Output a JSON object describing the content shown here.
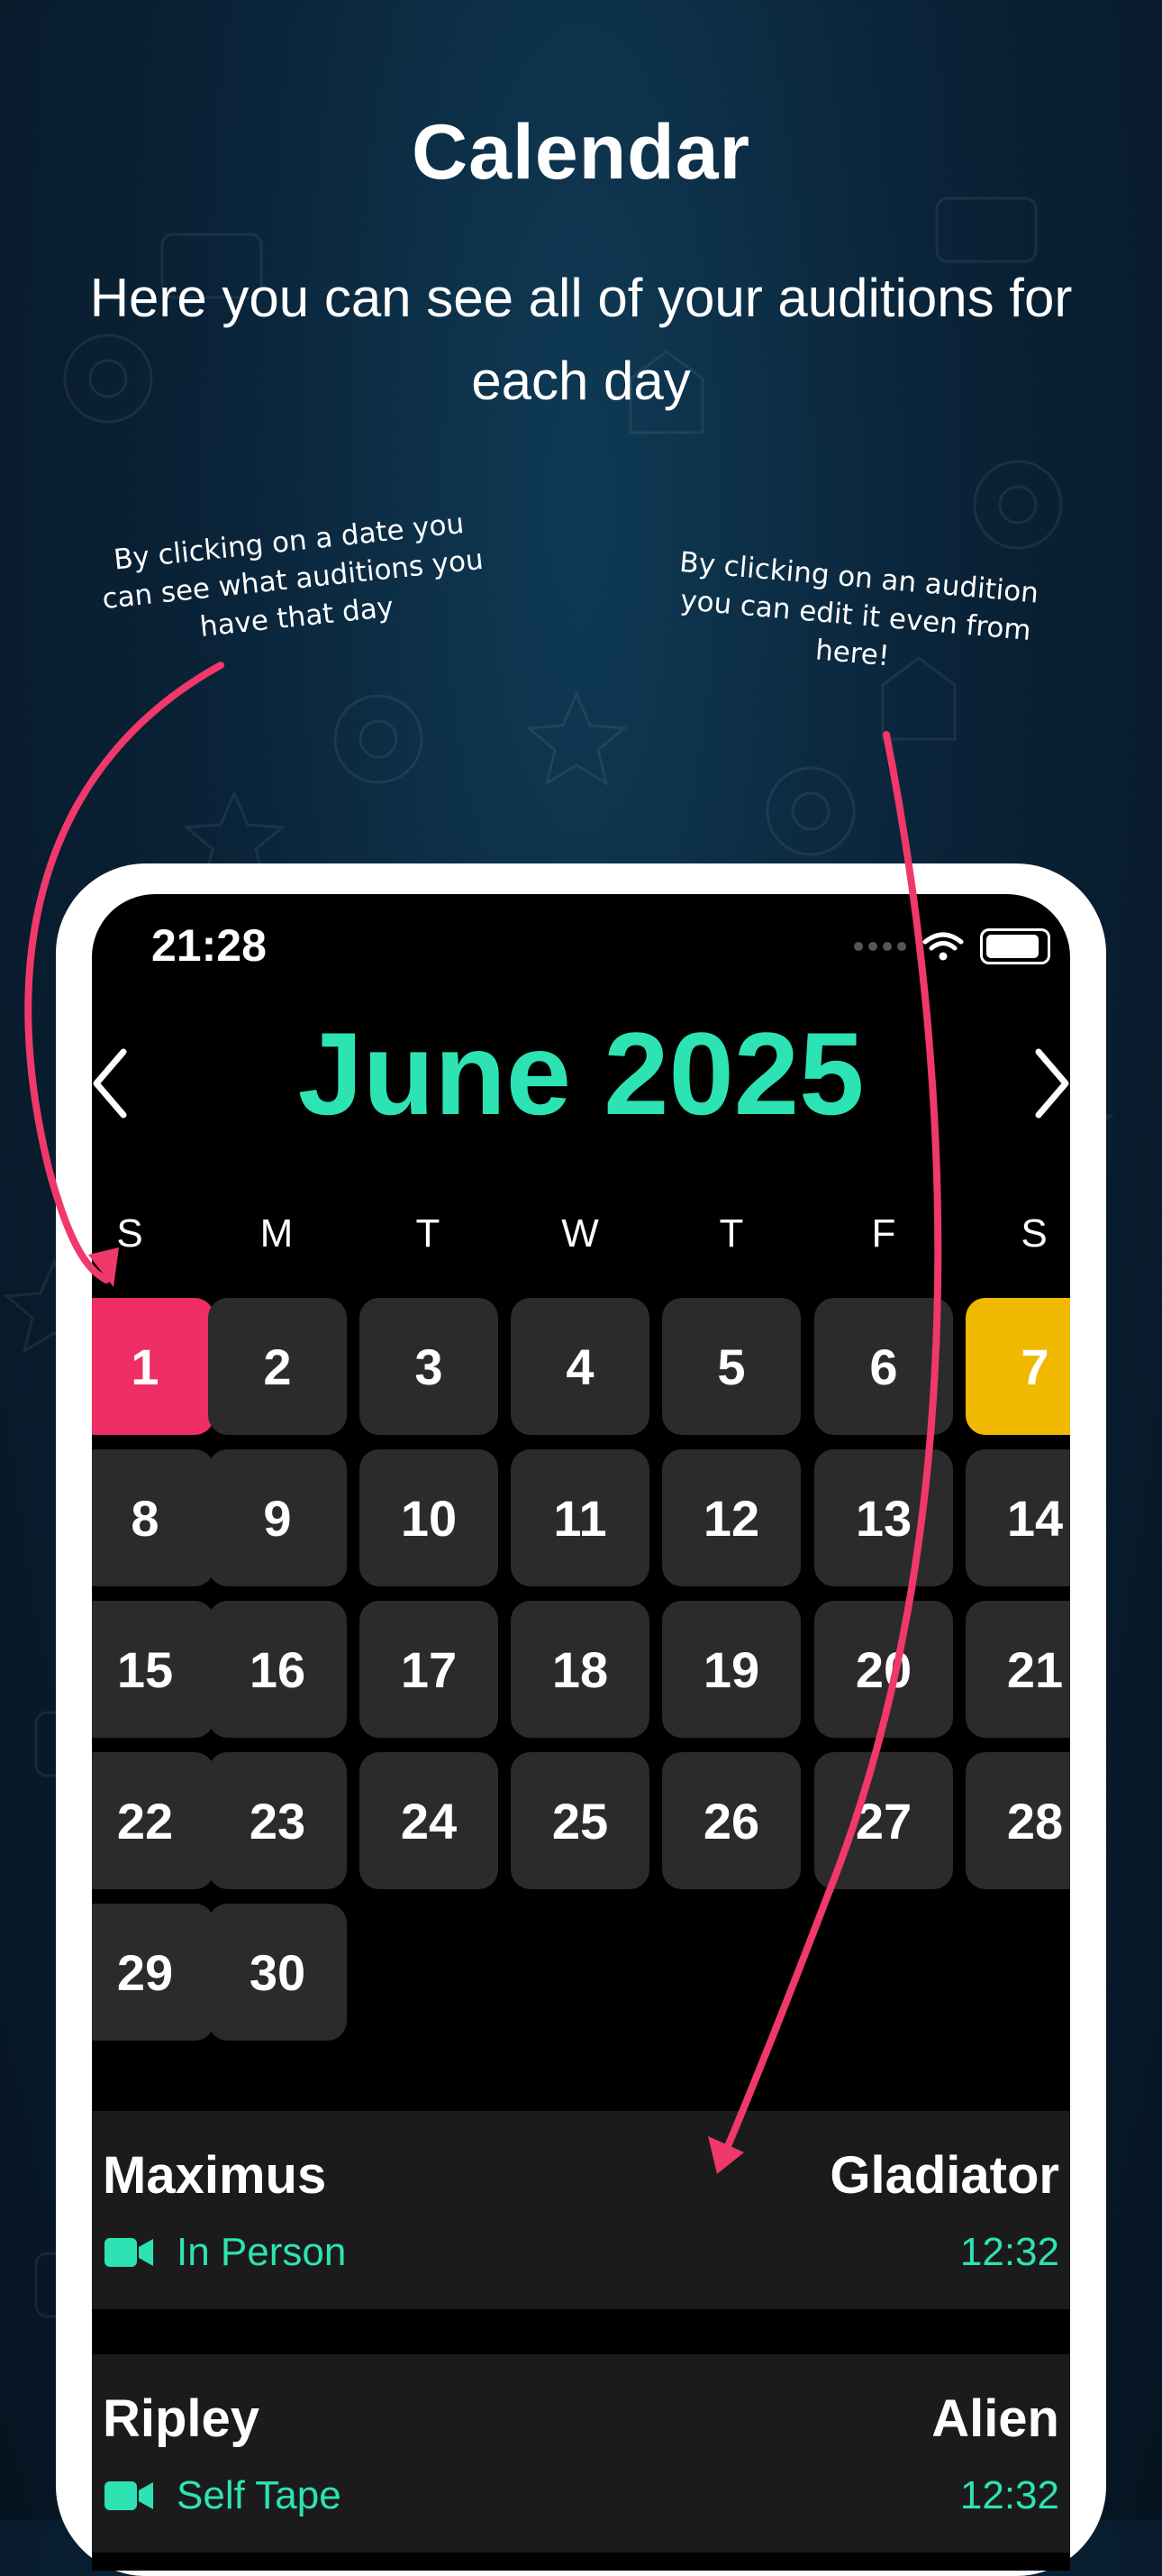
{
  "header": {
    "title": "Calendar",
    "subtitle": "Here you can see all of your auditions for each day"
  },
  "annotations": {
    "left": "By clicking on a date you can see what auditions you have that day",
    "right": "By clicking on an audition you can edit it even from here!"
  },
  "status_bar": {
    "time": "21:28"
  },
  "calendar": {
    "month_title": "June 2025",
    "weekdays": [
      "S",
      "M",
      "T",
      "W",
      "T",
      "F",
      "S"
    ],
    "days": [
      "1",
      "2",
      "3",
      "4",
      "5",
      "6",
      "7",
      "8",
      "9",
      "10",
      "11",
      "12",
      "13",
      "14",
      "15",
      "16",
      "17",
      "18",
      "19",
      "20",
      "21",
      "22",
      "23",
      "24",
      "25",
      "26",
      "27",
      "28",
      "29",
      "30"
    ],
    "selected_day": "1",
    "highlight_day": "7"
  },
  "auditions": [
    {
      "name": "Maximus",
      "film": "Gladiator",
      "type": "In Person",
      "time": "12:32"
    },
    {
      "name": "Ripley",
      "film": "Alien",
      "type": "Self Tape",
      "time": "12:32"
    }
  ],
  "colors": {
    "accent": "#2de3b4",
    "selected": "#ee2e64",
    "highlight": "#f0b900",
    "arrow": "#f0386b"
  },
  "icons": {
    "prev": "chevron-left-icon",
    "next": "chevron-right-icon",
    "video": "video-camera-icon",
    "wifi": "wifi-icon",
    "battery": "battery-icon"
  }
}
